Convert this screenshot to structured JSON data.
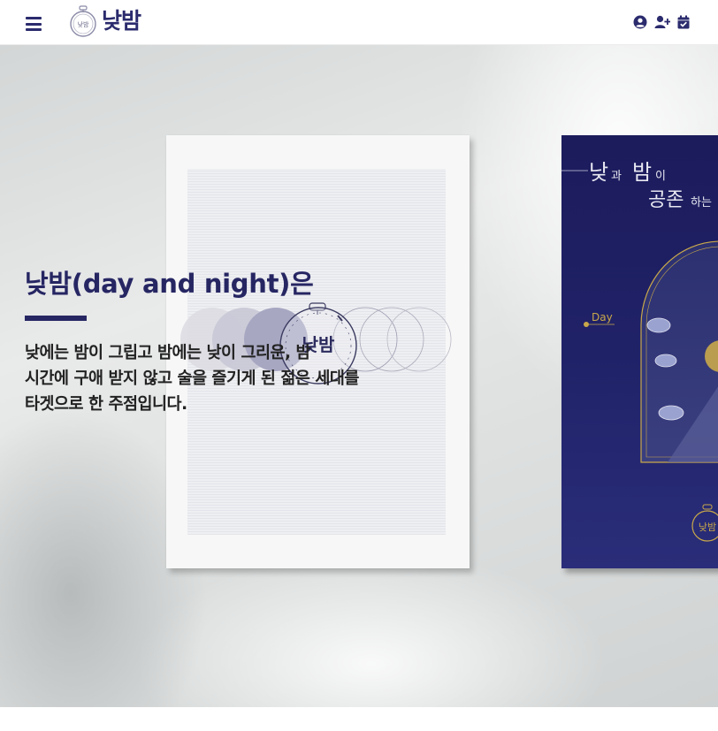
{
  "header": {
    "logo": {
      "text": "낮밤",
      "emblem_text": "낮밤"
    },
    "menu_icon": "bars-icon",
    "icons": [
      "user-circle-icon",
      "user-plus-icon",
      "calendar-check-icon"
    ]
  },
  "hero": {
    "title": "낮밤(day and night)은",
    "description_lines": [
      "낮에는 밤이 그립고 밤에는 낮이 그리운, 밤",
      "시간에 구애 받지 않고 술을 즐기게 된 젊은 세대를",
      "타겟으로 한 주점입니다."
    ]
  },
  "poster_white": {
    "emblem_text": "낮밤"
  },
  "poster_blue": {
    "headline_line1_big": "낮",
    "headline_line1_small": "과 ",
    "headline_line1_big2": "밤",
    "headline_line1_small2": "이",
    "headline_line2_big": "공존",
    "headline_line2_small": "하는",
    "day_label": "Day",
    "emblem_text": "낮밤"
  },
  "colors": {
    "brand_navy": "#2b2b6e",
    "title_navy": "#262663",
    "poster_blue": "#1f1f63",
    "gold": "#c9a84a"
  }
}
